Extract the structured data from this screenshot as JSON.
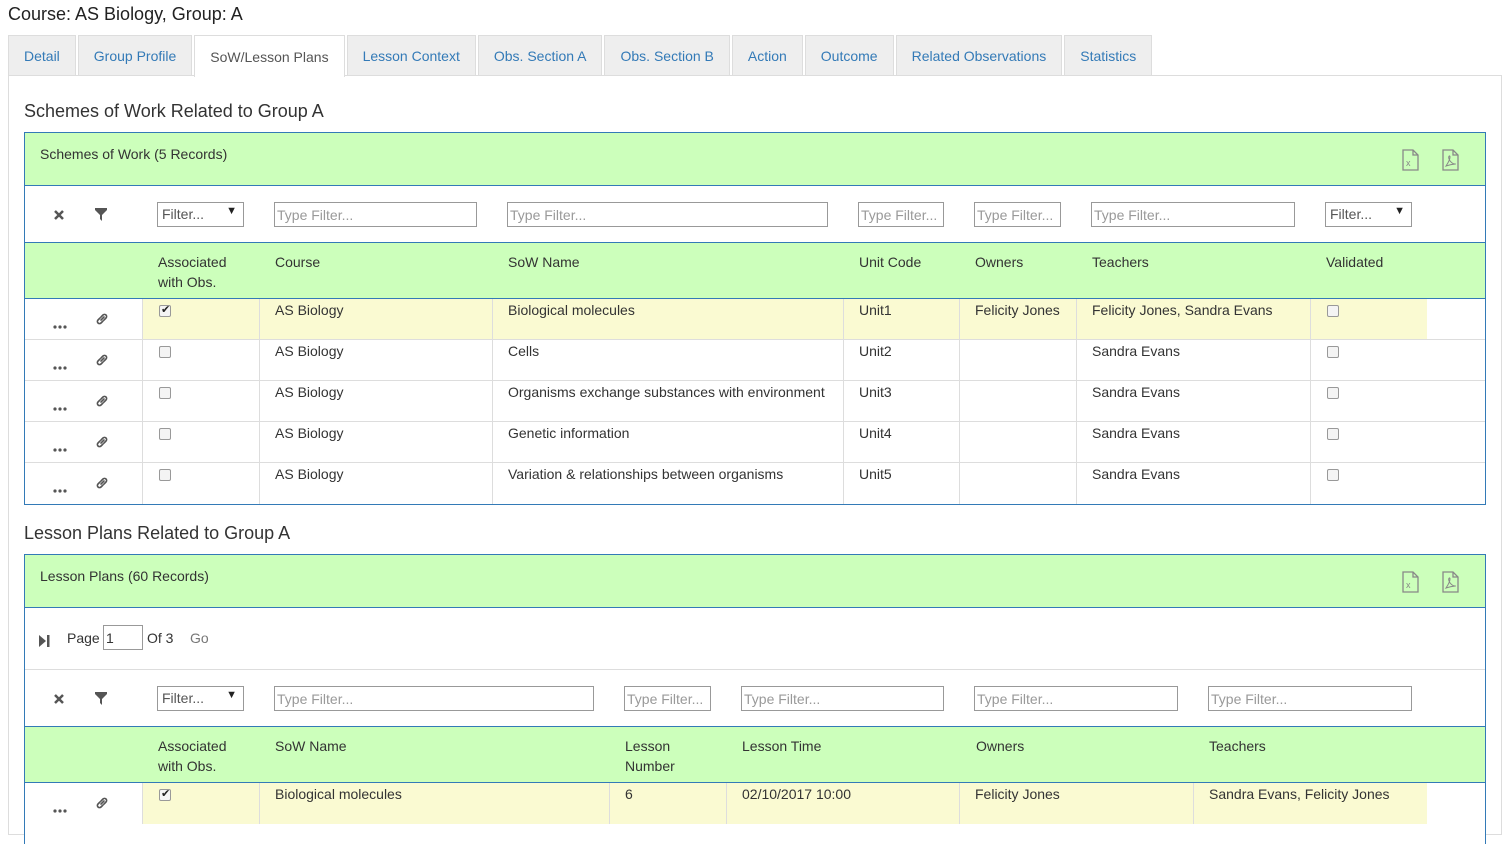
{
  "page": {
    "title": "Course: AS Biology, Group: A"
  },
  "tabs": [
    {
      "label": "Detail"
    },
    {
      "label": "Group Profile"
    },
    {
      "label": "SoW/Lesson Plans"
    },
    {
      "label": "Lesson Context"
    },
    {
      "label": "Obs. Section A"
    },
    {
      "label": "Obs. Section B"
    },
    {
      "label": "Action"
    },
    {
      "label": "Outcome"
    },
    {
      "label": "Related Observations"
    },
    {
      "label": "Statistics"
    }
  ],
  "active_tab": "SoW/Lesson Plans",
  "sow": {
    "heading": "Schemes of Work Related to Group A",
    "caption": "Schemes of Work (5 Records)",
    "filters": {
      "select_label": "Filter...",
      "placeholder": "Type Filter..."
    },
    "columns": {
      "assoc_line1": "Associated",
      "assoc_line2": "with Obs.",
      "course": "Course",
      "sow_name": "SoW Name",
      "unit_code": "Unit Code",
      "owners": "Owners",
      "teachers": "Teachers",
      "validated": "Validated"
    },
    "rows": [
      {
        "associated": true,
        "course": "AS Biology",
        "name": "Biological molecules",
        "unit": "Unit1",
        "owners": "Felicity Jones",
        "teachers": "Felicity Jones, Sandra Evans",
        "validated": false
      },
      {
        "associated": false,
        "course": "AS Biology",
        "name": "Cells",
        "unit": "Unit2",
        "owners": "",
        "teachers": "Sandra Evans",
        "validated": false
      },
      {
        "associated": false,
        "course": "AS Biology",
        "name": "Organisms exchange substances with environment",
        "unit": "Unit3",
        "owners": "",
        "teachers": "Sandra Evans",
        "validated": false
      },
      {
        "associated": false,
        "course": "AS Biology",
        "name": "Genetic information",
        "unit": "Unit4",
        "owners": "",
        "teachers": "Sandra Evans",
        "validated": false
      },
      {
        "associated": false,
        "course": "AS Biology",
        "name": "Variation & relationships between organisms",
        "unit": "Unit5",
        "owners": "",
        "teachers": "Sandra Evans",
        "validated": false
      }
    ]
  },
  "lessons": {
    "heading": "Lesson Plans Related to Group A",
    "caption": "Lesson Plans (60 Records)",
    "pager": {
      "page_label": "Page",
      "page_value": "1",
      "of_label": "Of 3",
      "go_label": "Go"
    },
    "filters": {
      "select_label": "Filter...",
      "placeholder": "Type Filter..."
    },
    "columns": {
      "assoc_line1": "Associated",
      "assoc_line2": "with Obs.",
      "sow_name": "SoW Name",
      "lesson_line1": "Lesson",
      "lesson_line2": "Number",
      "lesson_time": "Lesson Time",
      "owners": "Owners",
      "teachers": "Teachers"
    },
    "rows": [
      {
        "associated": true,
        "sow_name": "Biological molecules",
        "number": "6",
        "time": "02/10/2017 10:00",
        "owners": "Felicity Jones",
        "teachers": "Sandra Evans, Felicity Jones"
      }
    ]
  },
  "icons": {
    "clear_filter": "x-icon",
    "filter": "funnel-icon",
    "row_menu": "ellipsis-icon",
    "row_link": "link-icon",
    "export_excel": "excel-icon",
    "export_pdf": "pdf-icon",
    "pager_last": "skip-last-icon"
  },
  "colors": {
    "accent": "#337ab7",
    "header_green": "#ccffbb",
    "highlight": "#fafad2"
  }
}
